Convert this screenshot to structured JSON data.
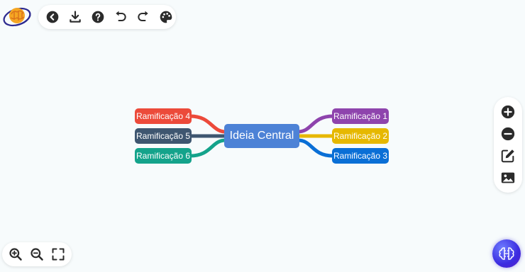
{
  "toolbar": {
    "buttons": [
      {
        "name": "back",
        "icon": "chevron-left-circle-icon"
      },
      {
        "name": "download",
        "icon": "download-icon"
      },
      {
        "name": "help",
        "icon": "help-circle-icon"
      },
      {
        "name": "undo",
        "icon": "undo-icon"
      },
      {
        "name": "redo",
        "icon": "redo-icon"
      },
      {
        "name": "theme",
        "icon": "palette-icon"
      }
    ]
  },
  "mindmap": {
    "central": {
      "label": "Ideia Central",
      "color": "#4d82d6"
    },
    "branches": [
      {
        "label": "Ramificação 1",
        "color": "#8e44ad"
      },
      {
        "label": "Ramificação 2",
        "color": "#e6b800"
      },
      {
        "label": "Ramificação 3",
        "color": "#0a6fd6"
      },
      {
        "label": "Ramificação 4",
        "color": "#ec4a3a"
      },
      {
        "label": "Ramificação 5",
        "color": "#3e5670"
      },
      {
        "label": "Ramificação 6",
        "color": "#14a38b"
      }
    ]
  },
  "right_panel": {
    "buttons": [
      {
        "name": "add-node",
        "icon": "plus-circle-icon"
      },
      {
        "name": "remove-node",
        "icon": "minus-circle-icon"
      },
      {
        "name": "edit-node",
        "icon": "edit-icon"
      },
      {
        "name": "insert-image",
        "icon": "image-icon"
      }
    ]
  },
  "zoom_controls": {
    "buttons": [
      {
        "name": "zoom-in",
        "icon": "zoom-in-icon"
      },
      {
        "name": "zoom-out",
        "icon": "zoom-out-icon"
      },
      {
        "name": "fullscreen",
        "icon": "fullscreen-icon"
      }
    ]
  },
  "ai_assistant": {
    "icon": "ai-brain-icon"
  },
  "colors": {
    "icon": "#2b2b2b",
    "background": "#f7fbfc"
  }
}
